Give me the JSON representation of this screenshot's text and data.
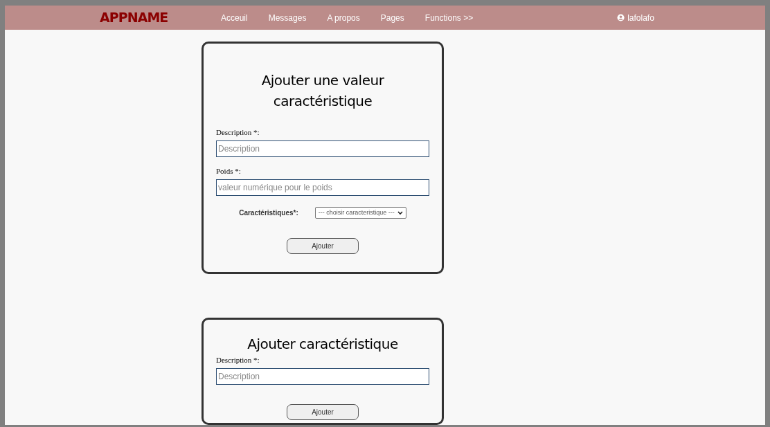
{
  "header": {
    "logo": "APPNAME",
    "nav": [
      {
        "label": "Acceuil"
      },
      {
        "label": "Messages"
      },
      {
        "label": "A propos"
      },
      {
        "label": "Pages"
      },
      {
        "label": "Functions >>"
      }
    ],
    "user": "lafolafo"
  },
  "forms": [
    {
      "title": "Ajouter une valeur caractéristique",
      "fields": [
        {
          "kind": "text",
          "label": "Description *:",
          "placeholder": "Description"
        },
        {
          "kind": "text",
          "label": "Poids *:",
          "placeholder": "valeur numérique pour le poids"
        },
        {
          "kind": "select",
          "label": "Caractéristiques*:",
          "value": "--- choisir caracteristique ---"
        }
      ],
      "button": "Ajouter"
    },
    {
      "title": "Ajouter caractéristique",
      "fields": [
        {
          "kind": "text",
          "label": "Description *:",
          "placeholder": "Description"
        }
      ],
      "button": "Ajouter"
    }
  ]
}
